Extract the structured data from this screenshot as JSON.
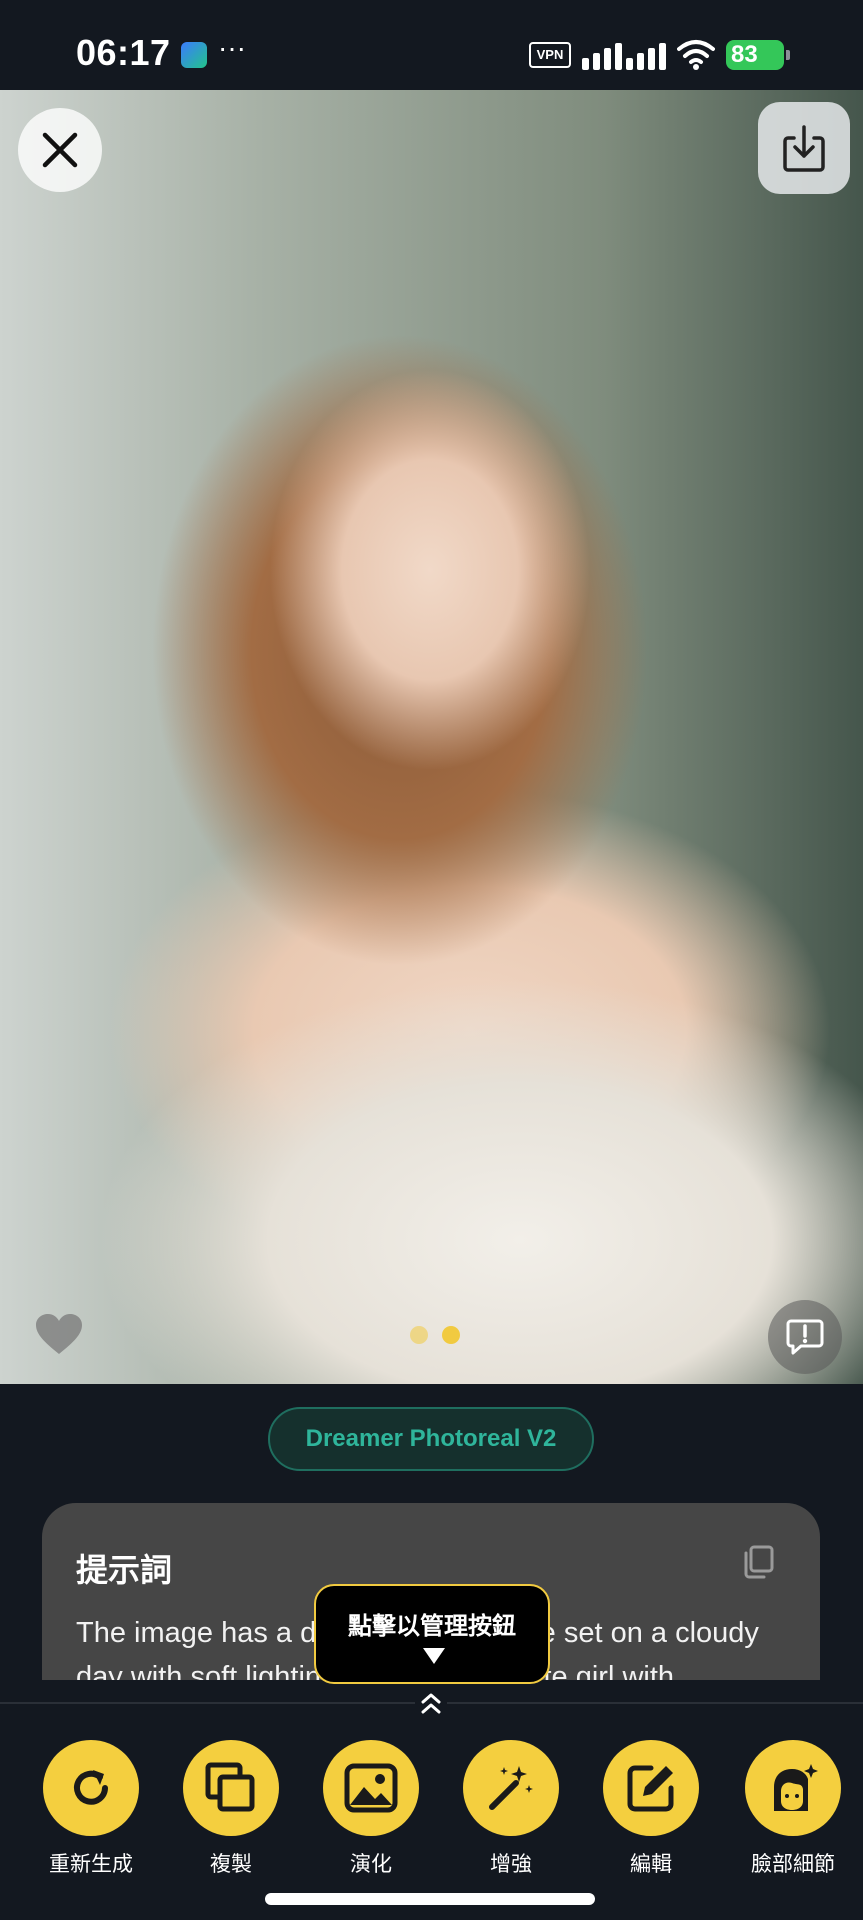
{
  "status_bar": {
    "time": "06:17",
    "dots": "···",
    "vpn": "VPN",
    "battery": "83"
  },
  "image_viewer": {
    "page_count": 2,
    "current_page": 2
  },
  "model_chip": {
    "label": "Dreamer Photoreal V2"
  },
  "prompt": {
    "title": "提示詞",
    "text": "The image has a dreamy, poetic style set on a cloudy day with soft lighting. Outdoors, a cute girl with"
  },
  "tooltip": {
    "text": "點擊以管理按鈕"
  },
  "actions": [
    {
      "label": "重新生成",
      "icon": "refresh-icon"
    },
    {
      "label": "複製",
      "icon": "copy-icon"
    },
    {
      "label": "演化",
      "icon": "image-icon"
    },
    {
      "label": "增強",
      "icon": "magic-wand-icon"
    },
    {
      "label": "編輯",
      "icon": "edit-icon"
    },
    {
      "label": "臉部細節",
      "icon": "face-sparkle-icon"
    }
  ],
  "colors": {
    "accent_yellow": "#f4cf3f",
    "chip_teal": "#2fb59b",
    "background": "#131820",
    "card": "#464646"
  }
}
